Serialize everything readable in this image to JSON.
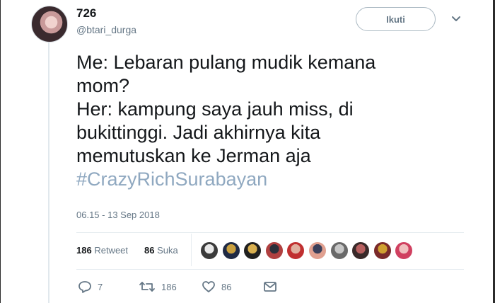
{
  "tweet": {
    "display_name": "726",
    "username": "@btari_durga",
    "follow_label": "Ikuti",
    "text_lines": [
      "Me: Lebaran pulang mudik kemana",
      "mom?",
      "Her: kampung saya jauh miss, di",
      "bukittinggi. Jadi akhirnya kita",
      "memutuskan ke Jerman aja"
    ],
    "hashtag": "#CrazyRichSurabayan",
    "timestamp": "06.15 - 13 Sep 2018"
  },
  "stats": {
    "retweet_count": "186",
    "retweet_label": "Retweet",
    "like_count": "86",
    "like_label": "Suka"
  },
  "liker_avatars": [
    {
      "colors": [
        "#e9e9e9",
        "#3b3b3b"
      ]
    },
    {
      "colors": [
        "#c9a040",
        "#1f2a44"
      ]
    },
    {
      "colors": [
        "#d9b050",
        "#202020"
      ]
    },
    {
      "colors": [
        "#2b2f3a",
        "#b04040"
      ]
    },
    {
      "colors": [
        "#e0b0a0",
        "#c03030"
      ]
    },
    {
      "colors": [
        "#3a3f5a",
        "#e0a090"
      ]
    },
    {
      "colors": [
        "#c8c8c8",
        "#6a6a6a"
      ]
    },
    {
      "colors": [
        "#b86060",
        "#3a2a2a"
      ]
    },
    {
      "colors": [
        "#d0a030",
        "#7a2a2a"
      ]
    },
    {
      "colors": [
        "#f0c0c0",
        "#d04060"
      ]
    }
  ],
  "actions": {
    "reply_count": "7",
    "retweet_count": "186",
    "like_count": "86"
  },
  "icons": {
    "reply": "reply-icon",
    "retweet": "retweet-icon",
    "like": "heart-icon",
    "dm": "envelope-icon",
    "caret": "chevron-down-icon"
  },
  "colors": {
    "text": "#14171a",
    "secondary": "#657786",
    "hashtag": "#8fa8c0",
    "divider": "#e6ecf0"
  }
}
